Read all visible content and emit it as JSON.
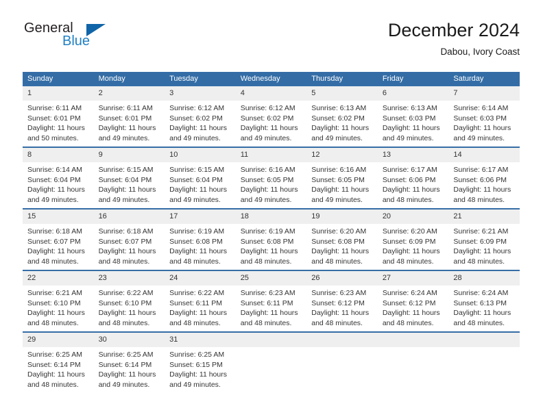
{
  "brand": {
    "name_part1": "General",
    "name_part2": "Blue",
    "triangle_color": "#1065a8",
    "blue_color": "#1f7fc4"
  },
  "header": {
    "title": "December 2024",
    "subtitle": "Dabou, Ivory Coast"
  },
  "theme": {
    "header_blue": "#346DA6",
    "daynum_band": "#efefef",
    "text": "#333333"
  },
  "weekdays": [
    "Sunday",
    "Monday",
    "Tuesday",
    "Wednesday",
    "Thursday",
    "Friday",
    "Saturday"
  ],
  "weeks": [
    [
      {
        "day": "1",
        "sunrise": "Sunrise: 6:11 AM",
        "sunset": "Sunset: 6:01 PM",
        "daylight1": "Daylight: 11 hours",
        "daylight2": "and 50 minutes."
      },
      {
        "day": "2",
        "sunrise": "Sunrise: 6:11 AM",
        "sunset": "Sunset: 6:01 PM",
        "daylight1": "Daylight: 11 hours",
        "daylight2": "and 49 minutes."
      },
      {
        "day": "3",
        "sunrise": "Sunrise: 6:12 AM",
        "sunset": "Sunset: 6:02 PM",
        "daylight1": "Daylight: 11 hours",
        "daylight2": "and 49 minutes."
      },
      {
        "day": "4",
        "sunrise": "Sunrise: 6:12 AM",
        "sunset": "Sunset: 6:02 PM",
        "daylight1": "Daylight: 11 hours",
        "daylight2": "and 49 minutes."
      },
      {
        "day": "5",
        "sunrise": "Sunrise: 6:13 AM",
        "sunset": "Sunset: 6:02 PM",
        "daylight1": "Daylight: 11 hours",
        "daylight2": "and 49 minutes."
      },
      {
        "day": "6",
        "sunrise": "Sunrise: 6:13 AM",
        "sunset": "Sunset: 6:03 PM",
        "daylight1": "Daylight: 11 hours",
        "daylight2": "and 49 minutes."
      },
      {
        "day": "7",
        "sunrise": "Sunrise: 6:14 AM",
        "sunset": "Sunset: 6:03 PM",
        "daylight1": "Daylight: 11 hours",
        "daylight2": "and 49 minutes."
      }
    ],
    [
      {
        "day": "8",
        "sunrise": "Sunrise: 6:14 AM",
        "sunset": "Sunset: 6:04 PM",
        "daylight1": "Daylight: 11 hours",
        "daylight2": "and 49 minutes."
      },
      {
        "day": "9",
        "sunrise": "Sunrise: 6:15 AM",
        "sunset": "Sunset: 6:04 PM",
        "daylight1": "Daylight: 11 hours",
        "daylight2": "and 49 minutes."
      },
      {
        "day": "10",
        "sunrise": "Sunrise: 6:15 AM",
        "sunset": "Sunset: 6:04 PM",
        "daylight1": "Daylight: 11 hours",
        "daylight2": "and 49 minutes."
      },
      {
        "day": "11",
        "sunrise": "Sunrise: 6:16 AM",
        "sunset": "Sunset: 6:05 PM",
        "daylight1": "Daylight: 11 hours",
        "daylight2": "and 49 minutes."
      },
      {
        "day": "12",
        "sunrise": "Sunrise: 6:16 AM",
        "sunset": "Sunset: 6:05 PM",
        "daylight1": "Daylight: 11 hours",
        "daylight2": "and 49 minutes."
      },
      {
        "day": "13",
        "sunrise": "Sunrise: 6:17 AM",
        "sunset": "Sunset: 6:06 PM",
        "daylight1": "Daylight: 11 hours",
        "daylight2": "and 48 minutes."
      },
      {
        "day": "14",
        "sunrise": "Sunrise: 6:17 AM",
        "sunset": "Sunset: 6:06 PM",
        "daylight1": "Daylight: 11 hours",
        "daylight2": "and 48 minutes."
      }
    ],
    [
      {
        "day": "15",
        "sunrise": "Sunrise: 6:18 AM",
        "sunset": "Sunset: 6:07 PM",
        "daylight1": "Daylight: 11 hours",
        "daylight2": "and 48 minutes."
      },
      {
        "day": "16",
        "sunrise": "Sunrise: 6:18 AM",
        "sunset": "Sunset: 6:07 PM",
        "daylight1": "Daylight: 11 hours",
        "daylight2": "and 48 minutes."
      },
      {
        "day": "17",
        "sunrise": "Sunrise: 6:19 AM",
        "sunset": "Sunset: 6:08 PM",
        "daylight1": "Daylight: 11 hours",
        "daylight2": "and 48 minutes."
      },
      {
        "day": "18",
        "sunrise": "Sunrise: 6:19 AM",
        "sunset": "Sunset: 6:08 PM",
        "daylight1": "Daylight: 11 hours",
        "daylight2": "and 48 minutes."
      },
      {
        "day": "19",
        "sunrise": "Sunrise: 6:20 AM",
        "sunset": "Sunset: 6:08 PM",
        "daylight1": "Daylight: 11 hours",
        "daylight2": "and 48 minutes."
      },
      {
        "day": "20",
        "sunrise": "Sunrise: 6:20 AM",
        "sunset": "Sunset: 6:09 PM",
        "daylight1": "Daylight: 11 hours",
        "daylight2": "and 48 minutes."
      },
      {
        "day": "21",
        "sunrise": "Sunrise: 6:21 AM",
        "sunset": "Sunset: 6:09 PM",
        "daylight1": "Daylight: 11 hours",
        "daylight2": "and 48 minutes."
      }
    ],
    [
      {
        "day": "22",
        "sunrise": "Sunrise: 6:21 AM",
        "sunset": "Sunset: 6:10 PM",
        "daylight1": "Daylight: 11 hours",
        "daylight2": "and 48 minutes."
      },
      {
        "day": "23",
        "sunrise": "Sunrise: 6:22 AM",
        "sunset": "Sunset: 6:10 PM",
        "daylight1": "Daylight: 11 hours",
        "daylight2": "and 48 minutes."
      },
      {
        "day": "24",
        "sunrise": "Sunrise: 6:22 AM",
        "sunset": "Sunset: 6:11 PM",
        "daylight1": "Daylight: 11 hours",
        "daylight2": "and 48 minutes."
      },
      {
        "day": "25",
        "sunrise": "Sunrise: 6:23 AM",
        "sunset": "Sunset: 6:11 PM",
        "daylight1": "Daylight: 11 hours",
        "daylight2": "and 48 minutes."
      },
      {
        "day": "26",
        "sunrise": "Sunrise: 6:23 AM",
        "sunset": "Sunset: 6:12 PM",
        "daylight1": "Daylight: 11 hours",
        "daylight2": "and 48 minutes."
      },
      {
        "day": "27",
        "sunrise": "Sunrise: 6:24 AM",
        "sunset": "Sunset: 6:12 PM",
        "daylight1": "Daylight: 11 hours",
        "daylight2": "and 48 minutes."
      },
      {
        "day": "28",
        "sunrise": "Sunrise: 6:24 AM",
        "sunset": "Sunset: 6:13 PM",
        "daylight1": "Daylight: 11 hours",
        "daylight2": "and 48 minutes."
      }
    ],
    [
      {
        "day": "29",
        "sunrise": "Sunrise: 6:25 AM",
        "sunset": "Sunset: 6:14 PM",
        "daylight1": "Daylight: 11 hours",
        "daylight2": "and 48 minutes."
      },
      {
        "day": "30",
        "sunrise": "Sunrise: 6:25 AM",
        "sunset": "Sunset: 6:14 PM",
        "daylight1": "Daylight: 11 hours",
        "daylight2": "and 49 minutes."
      },
      {
        "day": "31",
        "sunrise": "Sunrise: 6:25 AM",
        "sunset": "Sunset: 6:15 PM",
        "daylight1": "Daylight: 11 hours",
        "daylight2": "and 49 minutes."
      },
      {
        "day": "",
        "sunrise": "",
        "sunset": "",
        "daylight1": "",
        "daylight2": ""
      },
      {
        "day": "",
        "sunrise": "",
        "sunset": "",
        "daylight1": "",
        "daylight2": ""
      },
      {
        "day": "",
        "sunrise": "",
        "sunset": "",
        "daylight1": "",
        "daylight2": ""
      },
      {
        "day": "",
        "sunrise": "",
        "sunset": "",
        "daylight1": "",
        "daylight2": ""
      }
    ]
  ]
}
